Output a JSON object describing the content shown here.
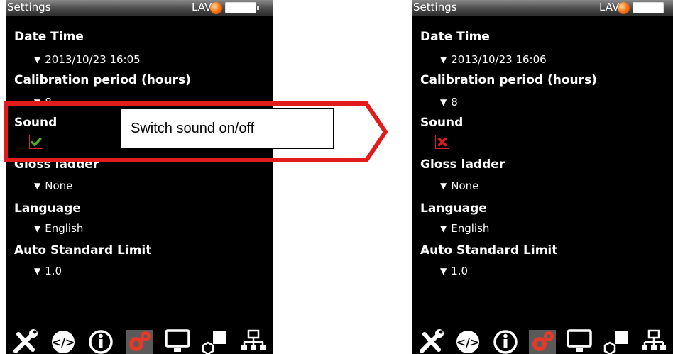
{
  "left_screen": {
    "statusbar": {
      "title": "Settings",
      "lav": "LAV",
      "led_color": "#ff7a1a"
    },
    "settings": [
      {
        "label": "Date Time",
        "value": "2013/10/23 16:05"
      },
      {
        "label": "Calibration period (hours)",
        "value": "8"
      },
      {
        "label": "Sound",
        "checkbox_state": "on"
      },
      {
        "label": "Gloss ladder",
        "value": "None"
      },
      {
        "label": "Language",
        "value": "English"
      },
      {
        "label": "Auto Standard Limit",
        "value": "1.0"
      }
    ]
  },
  "right_screen": {
    "statusbar": {
      "title": "Settings",
      "lav": "LAV",
      "led_color": "#ff7a1a"
    },
    "settings": [
      {
        "label": "Date Time",
        "value": "2013/10/23 16:06"
      },
      {
        "label": "Calibration period (hours)",
        "value": "8"
      },
      {
        "label": "Sound",
        "checkbox_state": "off"
      },
      {
        "label": "Gloss ladder",
        "value": "None"
      },
      {
        "label": "Language",
        "value": "English"
      },
      {
        "label": "Auto Standard Limit",
        "value": "1.0"
      }
    ]
  },
  "toolbar_icons": [
    "wrench-screwdriver-icon",
    "code-icon",
    "info-icon",
    "settings-gears-icon",
    "monitor-icon",
    "shapes-icon",
    "network-icon"
  ],
  "callout": {
    "text": "Switch sound on/off",
    "color": "#e21b1b"
  },
  "colors": {
    "check_green": "#4caf1e",
    "cross_red": "#d42020",
    "active_tool": "#e43a2a"
  }
}
